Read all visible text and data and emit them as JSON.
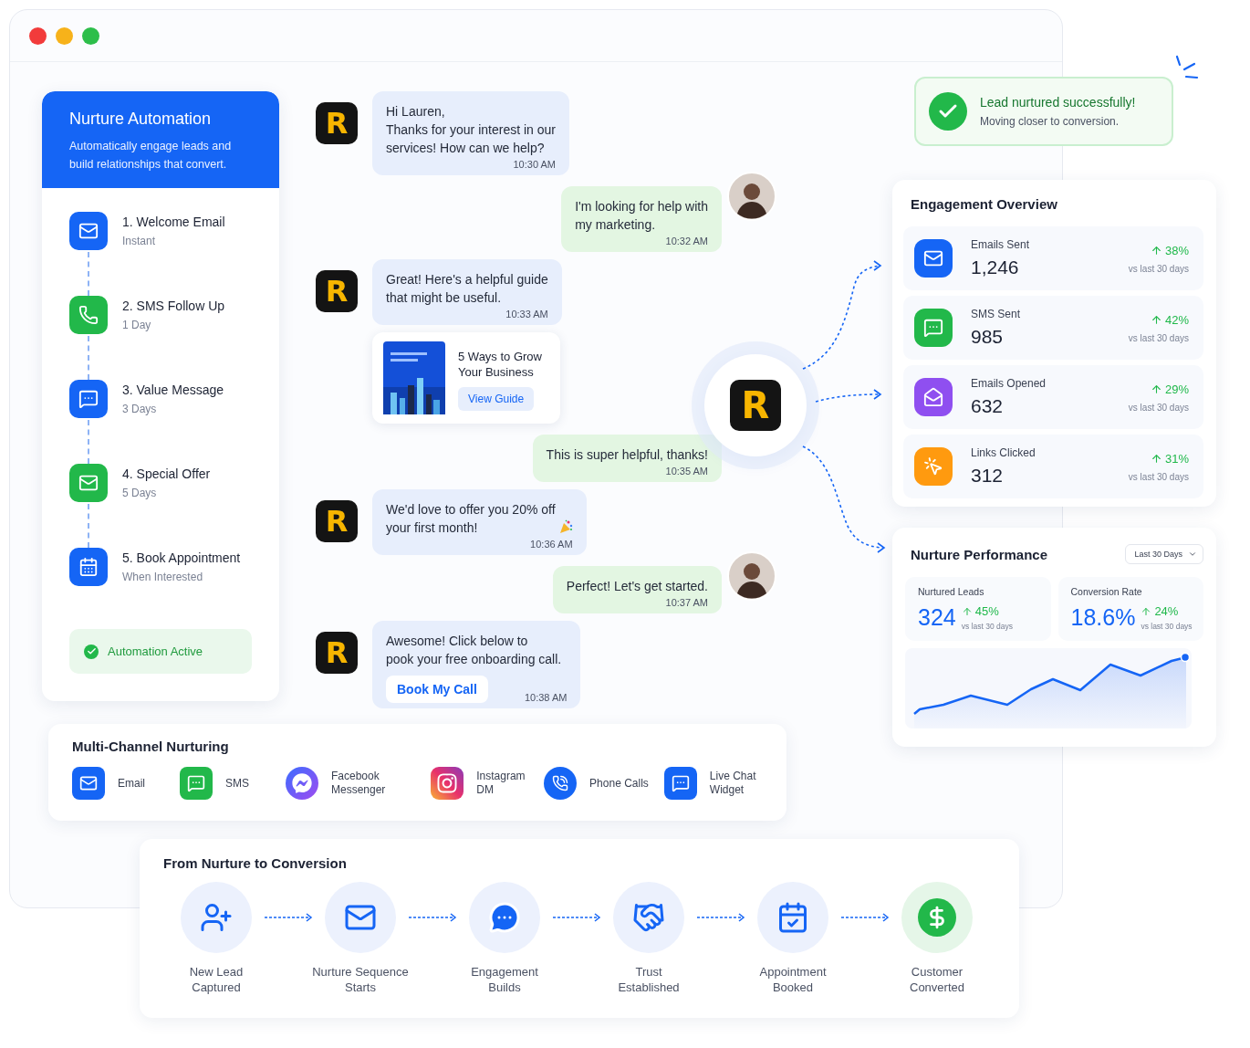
{
  "automation": {
    "title": "Nurture Automation",
    "subtitle": "Automatically engage leads and\nbuild relationships that convert.",
    "steps": [
      {
        "title": "1. Welcome Email",
        "timing": "Instant",
        "kind": "email",
        "color": "#1565f5"
      },
      {
        "title": "2. SMS Follow Up",
        "timing": "1 Day",
        "kind": "sms",
        "color": "#22b84a"
      },
      {
        "title": "3. Value Message",
        "timing": "3 Days",
        "kind": "message",
        "color": "#1565f5"
      },
      {
        "title": "4. Special Offer",
        "timing": "5 Days",
        "kind": "email",
        "color": "#22b84a"
      },
      {
        "title": "5. Book Appointment",
        "timing": "When Interested",
        "kind": "calendar",
        "color": "#1565f5"
      }
    ],
    "status": {
      "label": "Automation Active",
      "active": true
    }
  },
  "chat": [
    {
      "kind": "bot",
      "avatar": "R",
      "text": "Hi Lauren,\nThanks for your interest in our\nservices! How can we help?",
      "time": "10:30 AM"
    },
    {
      "kind": "user",
      "avatar": true,
      "text": "I'm looking for help with\nmy marketing.",
      "time": "10:32 AM"
    },
    {
      "kind": "bot",
      "avatar": "R",
      "text": "Great! Here's a helpful guide\nthat might be useful.",
      "time": "10:33 AM"
    },
    {
      "kind": "guide",
      "title": "5 Ways to Grow\nYour Business",
      "button": "View Guide"
    },
    {
      "kind": "user",
      "avatar": false,
      "text": "This is super helpful, thanks!",
      "time": "10:35 AM"
    },
    {
      "kind": "offer",
      "avatar": "R",
      "text": "We'd love to offer you 20% off\nyour first month!",
      "time": "10:36 AM"
    },
    {
      "kind": "user",
      "avatar": true,
      "text": "Perfect! Let's get started.",
      "time": "10:37 AM"
    },
    {
      "kind": "bot",
      "avatar": "R",
      "text": "Awesome! Click below to\npook your free onboarding call.",
      "button": "Book My Call",
      "time": "10:38 AM"
    }
  ],
  "hub": {
    "mark": "R"
  },
  "toast": {
    "title": "Lead nurtured successfully!",
    "subtitle": "Moving closer to conversion."
  },
  "engagement": {
    "title": "Engagement Overview",
    "metrics": [
      {
        "label": "Emails Sent",
        "value": "1,246",
        "change": "38%",
        "period": "vs last 30 days",
        "kind": "email",
        "color": "#1565f5"
      },
      {
        "label": "SMS Sent",
        "value": "985",
        "change": "42%",
        "period": "vs last 30 days",
        "kind": "sms",
        "color": "#22b84a"
      },
      {
        "label": "Emails Opened",
        "value": "632",
        "change": "29%",
        "period": "vs last 30 days",
        "kind": "opened",
        "color": "#8f4ff0"
      },
      {
        "label": "Links Clicked",
        "value": "312",
        "change": "31%",
        "period": "vs last 30 days",
        "kind": "click",
        "color": "#ff9a0f"
      }
    ]
  },
  "performance": {
    "title": "Nurture Performance",
    "range": "Last 30 Days",
    "stats": [
      {
        "label": "Nurtured Leads",
        "value": "324",
        "change": "45%",
        "period": "vs last 30 days"
      },
      {
        "label": "Conversion Rate",
        "value": "18.6%",
        "change": "24%",
        "period": "vs last 30 days"
      }
    ]
  },
  "channels": {
    "title": "Multi-Channel Nurturing",
    "items": [
      {
        "label": "Email",
        "kind": "email"
      },
      {
        "label": "SMS",
        "kind": "sms"
      },
      {
        "label": "Facebook\nMessenger",
        "kind": "messenger"
      },
      {
        "label": "Instagram\nDM",
        "kind": "instagram"
      },
      {
        "label": "Phone Calls",
        "kind": "phone"
      },
      {
        "label": "Live Chat\nWidget",
        "kind": "chat"
      }
    ]
  },
  "conversion": {
    "title": "From Nurture to Conversion",
    "steps": [
      {
        "label": "New Lead\nCaptured",
        "kind": "lead"
      },
      {
        "label": "Nurture Sequence\nStarts",
        "kind": "email"
      },
      {
        "label": "Engagement\nBuilds",
        "kind": "chat"
      },
      {
        "label": "Trust\nEstablished",
        "kind": "trust"
      },
      {
        "label": "Appointment\nBooked",
        "kind": "calendar"
      },
      {
        "label": "Customer\nConverted",
        "kind": "dollar"
      }
    ]
  }
}
